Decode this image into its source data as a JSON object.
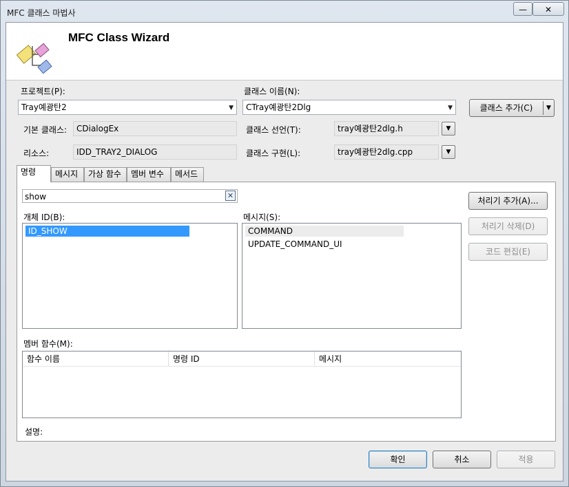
{
  "window": {
    "title": "MFC 클래스 마법사",
    "minimize_glyph": "—",
    "close_glyph": "✕"
  },
  "header": {
    "title": "MFC Class Wizard",
    "icon": "class-wizard-icon"
  },
  "project": {
    "label": "프로젝트(P):",
    "value": "Tray예광탄2"
  },
  "class_name": {
    "label": "클래스 이름(N):",
    "value": "CTray예광탄2Dlg"
  },
  "add_class_button": {
    "label": "클래스 추가(C)",
    "arrow": "▼"
  },
  "base_class": {
    "label": "기본 클래스:",
    "value": "CDialogEx"
  },
  "class_declaration": {
    "label": "클래스 선언(T):",
    "value": "tray예광탄2dlg.h"
  },
  "resource": {
    "label": "리소스:",
    "value": "IDD_TRAY2_DIALOG"
  },
  "class_implementation": {
    "label": "클래스 구현(L):",
    "value": "tray예광탄2dlg.cpp"
  },
  "tabs": [
    {
      "label": "명령",
      "active": true
    },
    {
      "label": "메시지",
      "active": false
    },
    {
      "label": "가상 함수",
      "active": false
    },
    {
      "label": "멤버 변수",
      "active": false
    },
    {
      "label": "메서드",
      "active": false
    }
  ],
  "search": {
    "value": "show",
    "clear_glyph": "✕"
  },
  "object_ids": {
    "label": "개체 ID(B):",
    "items": [
      "ID_SHOW"
    ],
    "selected": "ID_SHOW"
  },
  "messages": {
    "label": "메시지(S):",
    "items": [
      "COMMAND",
      "UPDATE_COMMAND_UI"
    ]
  },
  "handler_buttons": {
    "add": "처리기 추가(A)...",
    "delete": "처리기 삭제(D)",
    "edit": "코드 편집(E)"
  },
  "member_functions": {
    "label": "멤버 함수(M):",
    "columns": [
      "함수 이름",
      "명령 ID",
      "메시지"
    ],
    "rows": []
  },
  "description": {
    "label": "설명:"
  },
  "footer": {
    "ok": "확인",
    "cancel": "취소",
    "apply": "적용"
  },
  "dropdown_glyph": "▼"
}
